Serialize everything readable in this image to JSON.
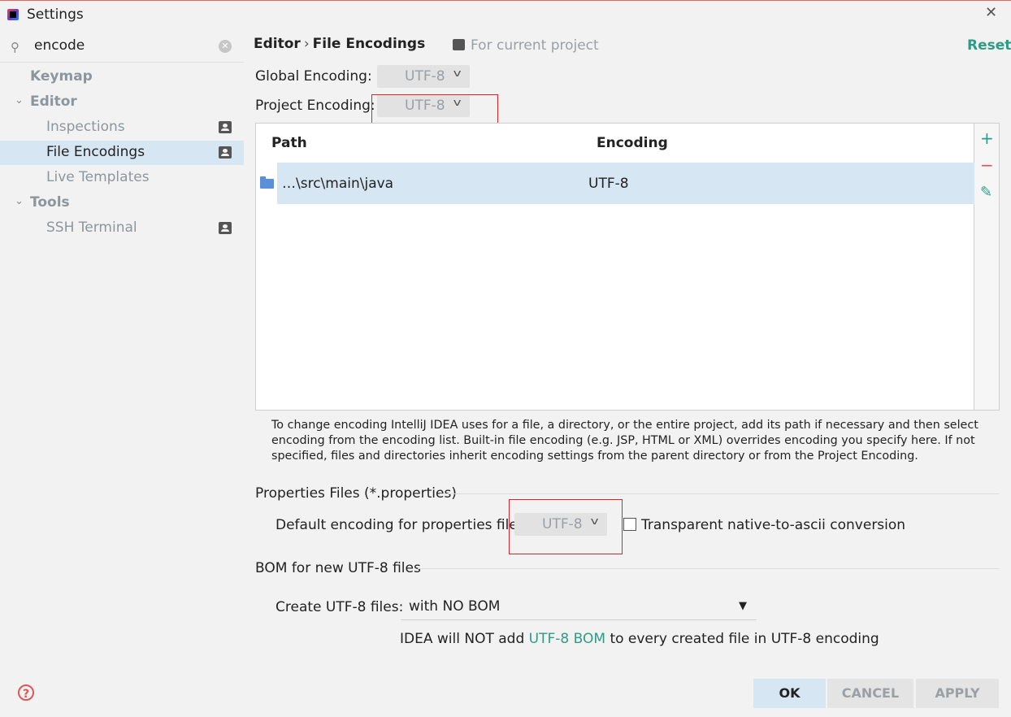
{
  "window": {
    "title": "Settings",
    "close_icon": "✕"
  },
  "search": {
    "value": "encode",
    "clear_icon": "✕",
    "search_icon": "⚲"
  },
  "sidebar": {
    "items": [
      {
        "label": "Keymap"
      },
      {
        "label": "Editor",
        "arrow": "⌄"
      },
      {
        "label": "Inspections"
      },
      {
        "label": "File Encodings"
      },
      {
        "label": "Live Templates"
      },
      {
        "label": "Tools",
        "arrow": "⌄"
      },
      {
        "label": "SSH Terminal"
      }
    ]
  },
  "header": {
    "crumb1": "Editor",
    "sep": "›",
    "crumb2": "File Encodings",
    "scope": "For current project",
    "reset": "Reset"
  },
  "global_encoding": {
    "label": "Global Encoding:",
    "value": "UTF-8"
  },
  "project_encoding": {
    "label": "Project Encoding:",
    "value": "UTF-8"
  },
  "table": {
    "col_path": "Path",
    "col_encoding": "Encoding",
    "rows": [
      {
        "path": "…\\src\\main\\java",
        "encoding": "UTF-8"
      }
    ]
  },
  "toolbar": {
    "add": "+",
    "remove": "−",
    "edit": "✎"
  },
  "description": "To change encoding IntelliJ IDEA uses for a file, a directory, or the entire project, add its path if necessary and then select encoding from the encoding list. Built-in file encoding (e.g. JSP, HTML or XML) overrides encoding you specify here. If not specified, files and directories inherit encoding settings from the parent directory or from the Project Encoding.",
  "properties": {
    "section": "Properties Files (*.properties)",
    "label": "Default encoding for properties files:",
    "value": "UTF-8",
    "checkbox_label": "Transparent native-to-ascii conversion"
  },
  "bom": {
    "section": "BOM for new UTF-8 files",
    "label": "Create UTF-8 files:",
    "value": "with NO BOM",
    "note_pre": "IDEA will NOT add",
    "note_link": "UTF-8 BOM",
    "note_post": "to every created file in UTF-8 encoding"
  },
  "buttons": {
    "ok": "OK",
    "cancel": "CANCEL",
    "apply": "APPLY"
  },
  "help_icon": "?",
  "colors": {
    "accent": "#2f9b85",
    "selection": "#d6e6f3",
    "highlight_box": "#d9262c",
    "remove": "#e05555",
    "add": "#2f9b85"
  }
}
